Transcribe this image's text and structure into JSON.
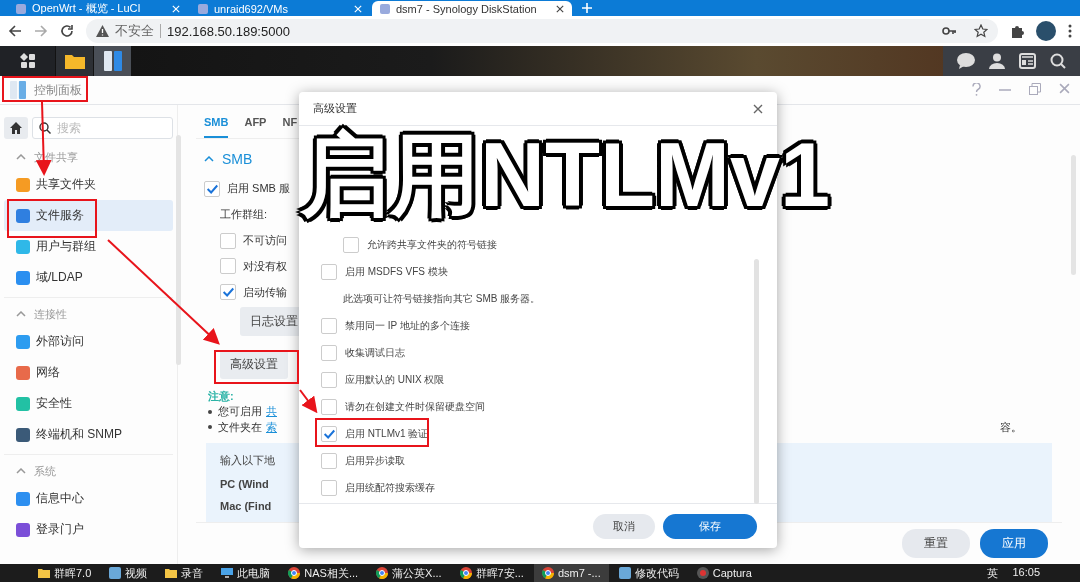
{
  "browser": {
    "tabs": [
      {
        "title": "OpenWrt - 概览 - LuCI",
        "selected": false
      },
      {
        "title": "unraid692/VMs",
        "selected": false
      },
      {
        "title": "dsm7 - Synology DiskStation",
        "selected": true
      }
    ],
    "address_bar": {
      "security": "不安全",
      "url": "192.168.50.189:5000"
    }
  },
  "window": {
    "title": "控制面板"
  },
  "sidebar": {
    "search": {
      "placeholder": "搜索"
    },
    "sections": [
      {
        "title": "文件共享",
        "expanded": true,
        "items": [
          {
            "label": "共享文件夹",
            "selected": false
          },
          {
            "label": "文件服务",
            "selected": true
          },
          {
            "label": "用户与群组",
            "selected": false
          },
          {
            "label": "域/LDAP",
            "selected": false
          }
        ]
      },
      {
        "title": "连接性",
        "expanded": true,
        "items": [
          {
            "label": "外部访问",
            "selected": false
          },
          {
            "label": "网络",
            "selected": false
          },
          {
            "label": "安全性",
            "selected": false
          },
          {
            "label": "终端机和 SNMP",
            "selected": false
          }
        ]
      },
      {
        "title": "系统",
        "expanded": true,
        "items": [
          {
            "label": "信息中心",
            "selected": false
          },
          {
            "label": "登录门户",
            "selected": false
          }
        ]
      }
    ]
  },
  "tabs": [
    {
      "label": "SMB",
      "selected": true
    },
    {
      "label": "AFP",
      "selected": false
    },
    {
      "label": "NF",
      "selected": false
    }
  ],
  "smb": {
    "title": "SMB",
    "expanded": true,
    "enable": {
      "label": "启用 SMB 服",
      "checked": true
    },
    "workgroup_label": "工作群组:",
    "options": [
      {
        "label": "不可访问",
        "checked": false
      },
      {
        "label": "对没有权",
        "checked": false
      },
      {
        "label": "启动传输",
        "checked": true
      }
    ],
    "log_button": "日志设置",
    "advanced_button": "高级设置",
    "note": {
      "title": "注意:",
      "lines": [
        {
          "text": "您可启用",
          "link": "共"
        },
        {
          "text": "文件夹在",
          "link": "索",
          "tail": "容。"
        }
      ]
    },
    "info_box": {
      "title": "输入以下地",
      "rows": [
        "PC (Wind",
        "Mac (Find"
      ]
    },
    "buttons": [
      {
        "label": "重置",
        "kind": "secondary"
      },
      {
        "label": "应用",
        "kind": "primary"
      }
    ]
  },
  "dialog": {
    "title": "高级设置",
    "options": [
      {
        "kind": "sub_checkbox",
        "label": "允许跨共享文件夹的符号链接",
        "checked": false
      },
      {
        "kind": "checkbox",
        "label": "启用 MSDFS VFS 模块",
        "checked": false
      },
      {
        "kind": "description",
        "label": "此选项可让符号链接指向其它 SMB 服务器。"
      },
      {
        "kind": "checkbox",
        "label": "禁用同一 IP 地址的多个连接",
        "checked": false
      },
      {
        "kind": "checkbox",
        "label": "收集调试日志",
        "checked": false
      },
      {
        "kind": "checkbox",
        "label": "应用默认的 UNIX 权限",
        "checked": false
      },
      {
        "kind": "checkbox",
        "label": "请勿在创建文件时保留硬盘空间",
        "checked": false
      },
      {
        "kind": "checkbox",
        "label": "启用 NTLMv1 验证",
        "checked": true
      },
      {
        "kind": "checkbox",
        "label": "启用异步读取",
        "checked": false
      },
      {
        "kind": "checkbox",
        "label": "启用统配符搜索缓存",
        "checked": false
      }
    ],
    "buttons": [
      {
        "label": "取消",
        "kind": "secondary"
      },
      {
        "label": "保存",
        "kind": "primary"
      }
    ]
  },
  "caption": "启用NTLMv1",
  "taskbar": {
    "items": [
      {
        "label": "群晖7.0",
        "kind": "folder",
        "selected": false
      },
      {
        "label": "视频",
        "kind": "app",
        "selected": false
      },
      {
        "label": "录音",
        "kind": "folder",
        "selected": false
      },
      {
        "label": "此电脑",
        "kind": "computer",
        "selected": false
      },
      {
        "label": "NAS相关...",
        "kind": "browser",
        "selected": false
      },
      {
        "label": "蒲公英X...",
        "kind": "browser",
        "selected": false
      },
      {
        "label": "群晖7安...",
        "kind": "browser",
        "selected": false
      },
      {
        "label": "dsm7 -...",
        "kind": "browser",
        "selected": true
      },
      {
        "label": "修改代码",
        "kind": "app",
        "selected": false
      },
      {
        "label": "Captura",
        "kind": "recorder",
        "selected": false
      }
    ],
    "ime": "英",
    "time": "16:05"
  }
}
